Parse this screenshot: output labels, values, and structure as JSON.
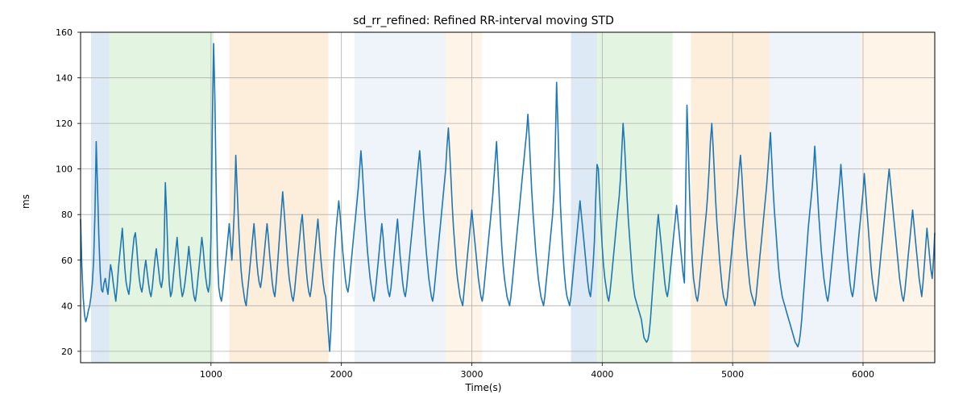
{
  "chart_data": {
    "type": "line",
    "title": "sd_rr_refined: Refined RR-interval moving STD",
    "xlabel": "Time(s)",
    "ylabel": "ms",
    "xlim": [
      0,
      6550
    ],
    "ylim": [
      15,
      160
    ],
    "xticks": [
      1000,
      2000,
      3000,
      4000,
      5000,
      6000
    ],
    "yticks": [
      20,
      40,
      60,
      80,
      100,
      120,
      140,
      160
    ],
    "bands": [
      {
        "x0": 80,
        "x1": 220,
        "color": "blue"
      },
      {
        "x0": 220,
        "x1": 1020,
        "color": "green"
      },
      {
        "x0": 1140,
        "x1": 1900,
        "color": "orange"
      },
      {
        "x0": 2100,
        "x1": 2800,
        "color": "ltblue"
      },
      {
        "x0": 2800,
        "x1": 3080,
        "color": "ltor"
      },
      {
        "x0": 3760,
        "x1": 3960,
        "color": "blue"
      },
      {
        "x0": 3960,
        "x1": 4540,
        "color": "green"
      },
      {
        "x0": 4680,
        "x1": 5280,
        "color": "orange"
      },
      {
        "x0": 5280,
        "x1": 5980,
        "color": "ltblue"
      },
      {
        "x0": 5980,
        "x1": 6100,
        "color": "ltor"
      },
      {
        "x0": 6100,
        "x1": 6550,
        "color": "ltor"
      }
    ],
    "series": [
      {
        "name": "sd_rr_refined",
        "x_step": 10,
        "values": [
          78,
          57,
          44,
          36,
          33,
          35,
          38,
          40,
          44,
          50,
          60,
          80,
          112,
          92,
          70,
          55,
          47,
          46,
          50,
          52,
          48,
          45,
          52,
          58,
          55,
          50,
          46,
          42,
          48,
          56,
          62,
          68,
          74,
          65,
          56,
          50,
          47,
          45,
          50,
          58,
          64,
          70,
          72,
          66,
          58,
          52,
          48,
          46,
          50,
          56,
          60,
          55,
          50,
          46,
          44,
          48,
          54,
          60,
          65,
          60,
          55,
          50,
          48,
          52,
          66,
          94,
          80,
          62,
          50,
          44,
          46,
          52,
          58,
          64,
          70,
          62,
          54,
          48,
          44,
          46,
          50,
          55,
          60,
          66,
          60,
          54,
          48,
          44,
          42,
          46,
          52,
          58,
          64,
          70,
          65,
          58,
          52,
          48,
          46,
          50,
          70,
          120,
          155,
          130,
          90,
          60,
          48,
          44,
          42,
          46,
          52,
          58,
          64,
          70,
          76,
          68,
          60,
          70,
          84,
          106,
          92,
          78,
          66,
          56,
          50,
          46,
          42,
          40,
          46,
          52,
          58,
          64,
          70,
          76,
          68,
          60,
          54,
          50,
          48,
          52,
          58,
          64,
          70,
          76,
          70,
          62,
          56,
          50,
          46,
          44,
          50,
          58,
          66,
          74,
          82,
          90,
          82,
          74,
          66,
          58,
          52,
          48,
          44,
          42,
          46,
          52,
          58,
          64,
          70,
          76,
          80,
          72,
          64,
          56,
          50,
          46,
          44,
          48,
          54,
          60,
          66,
          72,
          78,
          70,
          62,
          56,
          50,
          46,
          44,
          36,
          28,
          20,
          30,
          46,
          58,
          66,
          74,
          80,
          86,
          80,
          72,
          64,
          58,
          52,
          48,
          46,
          50,
          56,
          62,
          68,
          74,
          80,
          86,
          92,
          100,
          108,
          100,
          90,
          80,
          72,
          64,
          58,
          52,
          48,
          44,
          42,
          46,
          52,
          58,
          64,
          70,
          76,
          70,
          62,
          56,
          50,
          46,
          44,
          48,
          54,
          60,
          66,
          72,
          78,
          70,
          62,
          56,
          50,
          46,
          44,
          48,
          54,
          60,
          66,
          72,
          78,
          84,
          90,
          96,
          102,
          108,
          100,
          90,
          80,
          72,
          64,
          58,
          52,
          48,
          44,
          42,
          46,
          52,
          58,
          64,
          70,
          76,
          82,
          88,
          94,
          100,
          110,
          118,
          108,
          96,
          84,
          74,
          66,
          58,
          52,
          48,
          44,
          42,
          40,
          46,
          52,
          58,
          64,
          70,
          76,
          82,
          76,
          70,
          64,
          58,
          52,
          48,
          44,
          42,
          46,
          52,
          58,
          64,
          70,
          76,
          82,
          88,
          96,
          104,
          112,
          100,
          88,
          76,
          66,
          58,
          52,
          48,
          44,
          42,
          40,
          44,
          50,
          56,
          62,
          68,
          74,
          80,
          86,
          92,
          98,
          104,
          110,
          116,
          124,
          114,
          102,
          90,
          80,
          72,
          64,
          58,
          52,
          48,
          44,
          42,
          40,
          44,
          50,
          56,
          62,
          68,
          74,
          80,
          90,
          110,
          138,
          120,
          100,
          84,
          72,
          62,
          54,
          48,
          44,
          42,
          40,
          44,
          50,
          56,
          62,
          68,
          74,
          80,
          86,
          80,
          74,
          68,
          62,
          56,
          50,
          46,
          44,
          50,
          58,
          68,
          86,
          102,
          100,
          88,
          76,
          66,
          58,
          52,
          48,
          44,
          42,
          46,
          52,
          58,
          64,
          70,
          76,
          82,
          88,
          96,
          108,
          120,
          112,
          100,
          88,
          78,
          70,
          62,
          54,
          48,
          44,
          42,
          40,
          38,
          36,
          34,
          30,
          26,
          25,
          24,
          25,
          28,
          34,
          42,
          50,
          58,
          66,
          74,
          80,
          74,
          68,
          62,
          56,
          50,
          46,
          44,
          48,
          54,
          60,
          66,
          72,
          78,
          84,
          78,
          72,
          66,
          60,
          54,
          50,
          90,
          128,
          110,
          88,
          72,
          60,
          52,
          48,
          44,
          42,
          46,
          52,
          58,
          64,
          70,
          76,
          82,
          90,
          100,
          112,
          120,
          110,
          98,
          86,
          76,
          68,
          60,
          54,
          48,
          44,
          42,
          40,
          44,
          50,
          56,
          62,
          68,
          74,
          80,
          86,
          92,
          100,
          106,
          98,
          88,
          78,
          70,
          62,
          56,
          50,
          46,
          44,
          42,
          40,
          44,
          50,
          56,
          62,
          68,
          74,
          80,
          86,
          92,
          100,
          108,
          116,
          104,
          92,
          82,
          74,
          66,
          58,
          52,
          48,
          44,
          42,
          40,
          38,
          36,
          34,
          32,
          30,
          28,
          26,
          24,
          23,
          22,
          24,
          28,
          34,
          42,
          50,
          58,
          66,
          74,
          80,
          86,
          92,
          100,
          110,
          100,
          90,
          80,
          72,
          64,
          58,
          52,
          48,
          44,
          42,
          46,
          52,
          58,
          64,
          70,
          76,
          82,
          88,
          94,
          102,
          94,
          86,
          78,
          70,
          62,
          56,
          50,
          46,
          44,
          48,
          54,
          60,
          66,
          72,
          78,
          84,
          90,
          98,
          90,
          82,
          74,
          66,
          58,
          52,
          48,
          44,
          42,
          46,
          52,
          58,
          64,
          70,
          76,
          82,
          88,
          94,
          100,
          94,
          88,
          82,
          76,
          70,
          64,
          58,
          52,
          48,
          44,
          42,
          46,
          52,
          58,
          64,
          70,
          76,
          82,
          76,
          70,
          64,
          58,
          52,
          48,
          44,
          50,
          58,
          66,
          74,
          68,
          62,
          56,
          52,
          60,
          72
        ]
      }
    ]
  }
}
